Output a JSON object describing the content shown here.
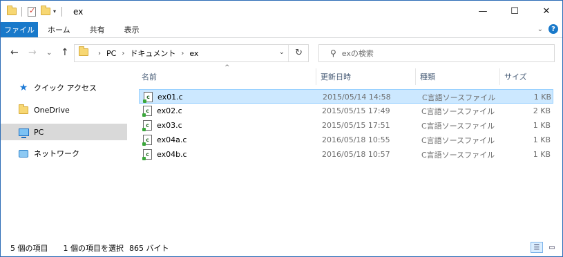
{
  "window": {
    "title": "ex"
  },
  "titlebar": {
    "minimize": "—",
    "maximize": "☐",
    "close": "✕",
    "qa_dropdown": "▾"
  },
  "ribbon": {
    "tabs": [
      "ファイル",
      "ホーム",
      "共有",
      "表示"
    ],
    "expand_icon": "⌄",
    "help_label": "?"
  },
  "nav": {
    "back": "←",
    "forward": "→",
    "recent": "⌄",
    "up": "↑",
    "breadcrumb": [
      "PC",
      "ドキュメント",
      "ex"
    ],
    "breadcrumb_sep": "›",
    "dropdown": "⌄",
    "refresh": "↻",
    "search_placeholder": "exの検索",
    "search_icon": "⚲"
  },
  "sidebar": {
    "items": [
      {
        "label": "クイック アクセス",
        "icon": "star-icon"
      },
      {
        "label": "OneDrive",
        "icon": "onedrive-folder-icon"
      },
      {
        "label": "PC",
        "icon": "computer-icon"
      },
      {
        "label": "ネットワーク",
        "icon": "network-icon"
      }
    ],
    "active_index": 2
  },
  "list": {
    "columns": [
      "名前",
      "更新日時",
      "種類",
      "サイズ"
    ],
    "sort_indicator": "^",
    "rows": [
      {
        "name": "ex01.c",
        "date": "2015/05/14 14:58",
        "type": "C言語ソースファイル",
        "size": "1 KB",
        "selected": true
      },
      {
        "name": "ex02.c",
        "date": "2015/05/15 17:49",
        "type": "C言語ソースファイル",
        "size": "2 KB",
        "selected": false
      },
      {
        "name": "ex03.c",
        "date": "2015/05/15 17:51",
        "type": "C言語ソースファイル",
        "size": "1 KB",
        "selected": false
      },
      {
        "name": "ex04a.c",
        "date": "2016/05/18 10:55",
        "type": "C言語ソースファイル",
        "size": "1 KB",
        "selected": false
      },
      {
        "name": "ex04b.c",
        "date": "2016/05/18 10:57",
        "type": "C言語ソースファイル",
        "size": "1 KB",
        "selected": false
      }
    ],
    "file_icon_glyph": "c"
  },
  "status": {
    "item_count": "5 個の項目",
    "selection": "1 個の項目を選択",
    "size": "865 バイト",
    "details_view_icon": "☰",
    "large_icons_view_icon": "▭"
  },
  "colors": {
    "accent": "#1979ca",
    "selected_row": "#cce8ff",
    "sidebar_active": "#d9d9d9"
  }
}
